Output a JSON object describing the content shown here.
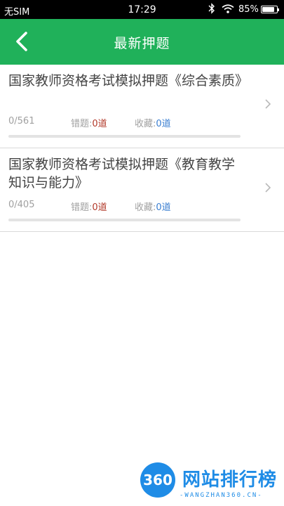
{
  "status_bar": {
    "carrier": "无SIM",
    "time": "17:29",
    "battery_text": "85%",
    "battery_level": 0.85
  },
  "nav": {
    "title": "最新押题",
    "back_icon": "chevron-left-icon"
  },
  "items": [
    {
      "title": "国家教师资格考试模拟押题《综合素质》",
      "progress": "0/561",
      "progress_fraction": 0,
      "wrong_label": "错题:",
      "wrong_value": "0道",
      "fav_label": "收藏:",
      "fav_value": "0道"
    },
    {
      "title": "国家教师资格考试模拟押题《教育教学知识与能力》",
      "progress": "0/405",
      "progress_fraction": 0,
      "wrong_label": "错题:",
      "wrong_value": "0道",
      "fav_label": "收藏:",
      "fav_value": "0道"
    }
  ],
  "watermark": {
    "logo_text": "360",
    "brand": "网站排行榜",
    "url": "-WANGZHAN360.CN-"
  },
  "colors": {
    "accent": "#20b15a",
    "wrong": "#b23a2a",
    "fav": "#3b7fd1"
  }
}
